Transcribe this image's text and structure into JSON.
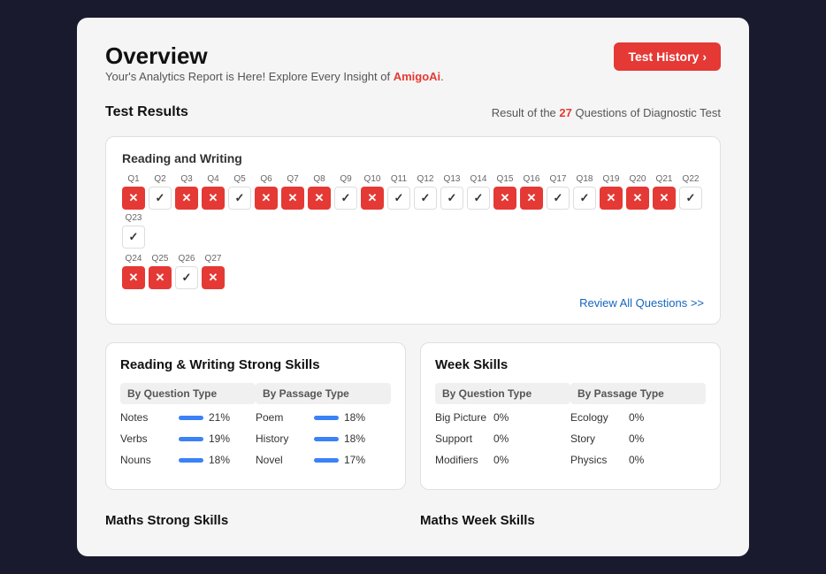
{
  "header": {
    "title": "Overview",
    "subtitle_prefix": "Your's Analytics Report is Here! Explore Every Insight of ",
    "brand": "AmigoAi",
    "subtitle_suffix": "."
  },
  "test_history_btn": {
    "label": "Test History",
    "arrow": "›"
  },
  "test_results": {
    "section_title": "Test Results",
    "result_prefix": "Result of the ",
    "result_count": "27",
    "result_suffix": " Questions of Diagnostic Test",
    "rw_title": "Reading and Writing",
    "questions_row1": [
      {
        "label": "Q1",
        "status": "wrong"
      },
      {
        "label": "Q2",
        "status": "correct"
      },
      {
        "label": "Q3",
        "status": "wrong"
      },
      {
        "label": "Q4",
        "status": "wrong"
      },
      {
        "label": "Q5",
        "status": "correct"
      },
      {
        "label": "Q6",
        "status": "wrong"
      },
      {
        "label": "Q7",
        "status": "wrong"
      },
      {
        "label": "Q8",
        "status": "wrong"
      },
      {
        "label": "Q9",
        "status": "correct"
      },
      {
        "label": "Q10",
        "status": "wrong"
      },
      {
        "label": "Q11",
        "status": "correct"
      },
      {
        "label": "Q12",
        "status": "correct"
      },
      {
        "label": "Q13",
        "status": "correct"
      },
      {
        "label": "Q14",
        "status": "correct"
      },
      {
        "label": "Q15",
        "status": "wrong"
      },
      {
        "label": "Q16",
        "status": "wrong"
      },
      {
        "label": "Q17",
        "status": "correct"
      },
      {
        "label": "Q18",
        "status": "correct"
      },
      {
        "label": "Q19",
        "status": "wrong"
      },
      {
        "label": "Q20",
        "status": "wrong"
      },
      {
        "label": "Q21",
        "status": "wrong"
      },
      {
        "label": "Q22",
        "status": "correct"
      },
      {
        "label": "Q23",
        "status": "correct"
      }
    ],
    "questions_row2": [
      {
        "label": "Q24",
        "status": "wrong"
      },
      {
        "label": "Q25",
        "status": "wrong"
      },
      {
        "label": "Q26",
        "status": "correct"
      },
      {
        "label": "Q27",
        "status": "wrong"
      }
    ],
    "review_link": "Review All Questions >>"
  },
  "strong_skills": {
    "title": "Reading & Writing Strong Skills",
    "by_question_type_header": "By Question Type",
    "by_passage_type_header": "By Passage Type",
    "question_types": [
      {
        "name": "Notes",
        "pct": "21%"
      },
      {
        "name": "Verbs",
        "pct": "19%"
      },
      {
        "name": "Nouns",
        "pct": "18%"
      }
    ],
    "passage_types": [
      {
        "name": "Poem",
        "pct": "18%"
      },
      {
        "name": "History",
        "pct": "18%"
      },
      {
        "name": "Novel",
        "pct": "17%"
      }
    ]
  },
  "week_skills": {
    "title": "Week Skills",
    "by_question_type_header": "By Question Type",
    "by_passage_type_header": "By Passage Type",
    "question_types": [
      {
        "name": "Big Picture",
        "pct": "0%"
      },
      {
        "name": "Support",
        "pct": "0%"
      },
      {
        "name": "Modifiers",
        "pct": "0%"
      }
    ],
    "passage_types": [
      {
        "name": "Ecology",
        "pct": "0%"
      },
      {
        "name": "Story",
        "pct": "0%"
      },
      {
        "name": "Physics",
        "pct": "0%"
      }
    ]
  },
  "bottom": {
    "maths_strong": "Maths Strong Skills",
    "maths_week": "Maths Week Skills"
  }
}
